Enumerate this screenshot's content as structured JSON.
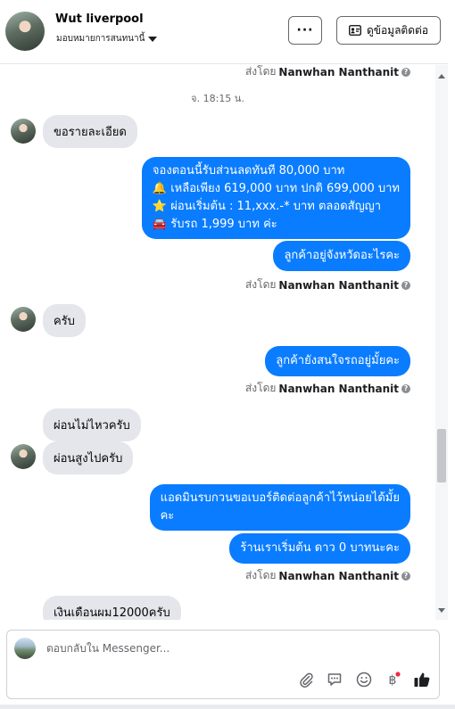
{
  "header": {
    "name": "Wut liverpool",
    "assign_label": "มอบหมายการสนทนานี้",
    "more_label": "···",
    "contact_label": "ดูข้อมูลติดต่อ"
  },
  "sent_by_prefix": "ส่งโดย",
  "sender": "Nanwhan Nanthanit",
  "timestamp": "จ. 18:15 น.",
  "messages": {
    "m1": "ขอรายละเอียด",
    "m2": {
      "line1": "จองตอนนี้รับส่วนลดทันที 80,000 บาท",
      "line2": "🔔 เหลือเพียง 619,000 บาท ปกติ 699,000 บาท",
      "line3": "⭐ ผ่อนเริ่มต้น  : 11,xxx.-* บาท ตลอดสัญญา",
      "line4": "🚘 รับรถ 1,999 บาท  ค่ะ"
    },
    "m3": "ลูกค้าอยู่จังหวัดอะไรคะ",
    "m4": "ครับ",
    "m5": "ลูกค้ายังสนใจรถอยู่มั้ยคะ",
    "m6": "ผ่อนไม่ไหวครับ",
    "m7": "ผ่อนสูงไปครับ",
    "m8": {
      "line1": "แอดมินรบกวนขอเบอร์ติดต่อลูกค้าไว้หน่อยได้มั้ย",
      "line2": "คะ"
    },
    "m9": "ร้านเราเริ่มต้น ดาว 0 บาทนะคะ",
    "m10": "เงินเดือนผม12000ครับ"
  },
  "composer": {
    "placeholder": "ตอบกลับใน Messenger...",
    "icons": [
      "attach-icon",
      "saved-reply-icon",
      "emoji-icon",
      "payment-icon",
      "like-icon"
    ],
    "accent_color": "#0a7cff",
    "notification_dot_color": "#f02849"
  }
}
